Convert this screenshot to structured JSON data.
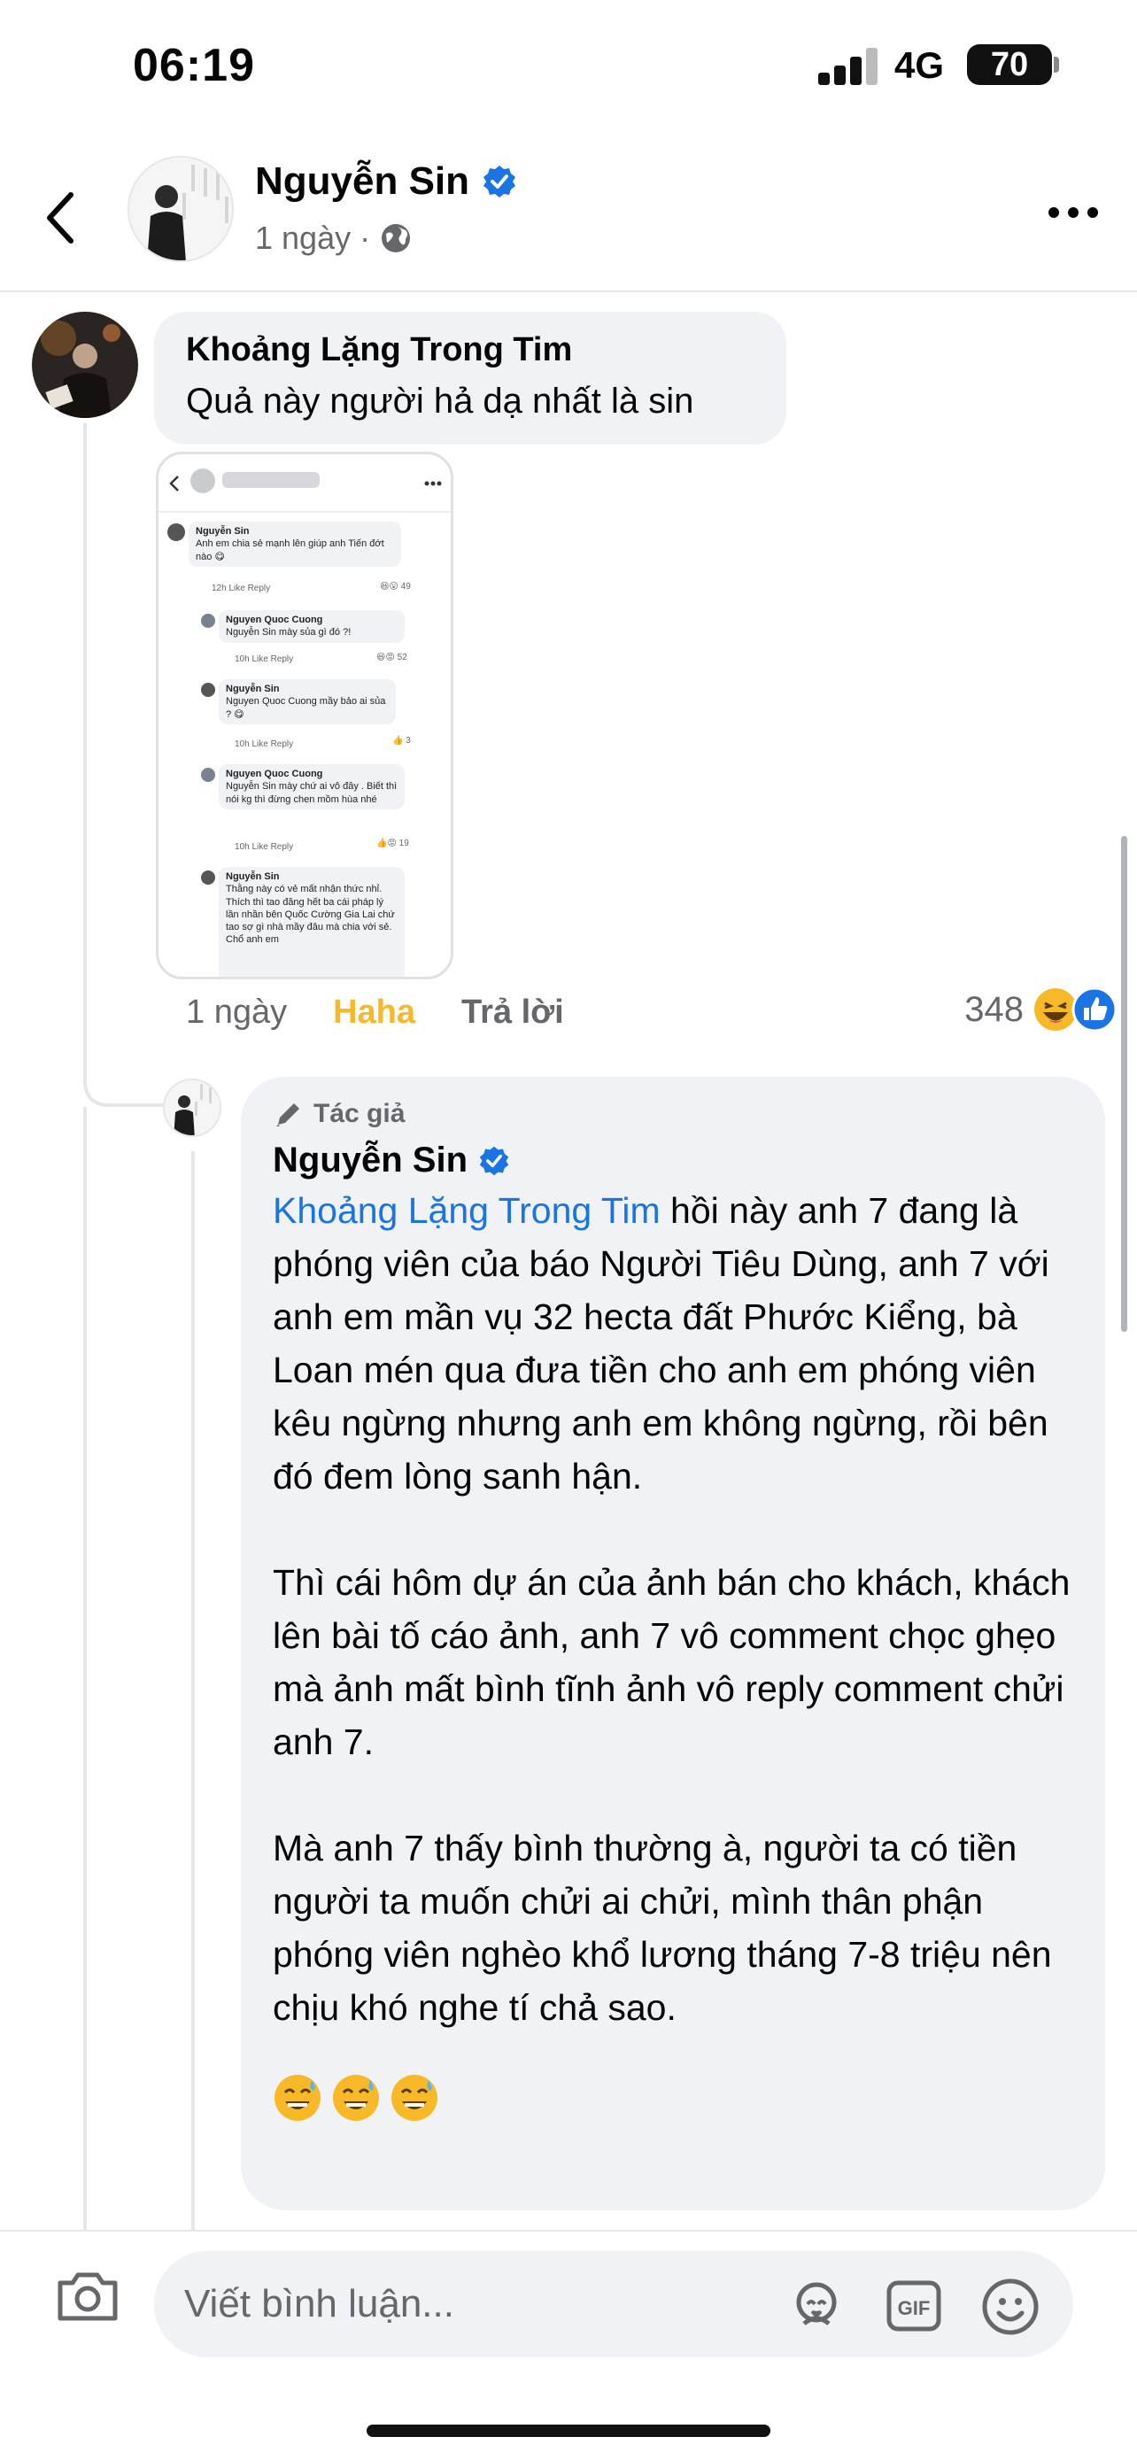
{
  "status_bar": {
    "time": "06:19",
    "network": "4G",
    "battery": "70"
  },
  "header": {
    "name": "Nguyễn Sin",
    "meta_time": "1 ngày",
    "meta_dot": "·",
    "icons": {
      "back": "chevron-left-icon",
      "verified": "verified-badge-icon",
      "audience": "globe-icon",
      "more": "more-dots-icon"
    }
  },
  "comment": {
    "author": "Khoảng Lặng Trong Tim",
    "text": "Quả này người hả dạ nhất là sin",
    "time": "1 ngày",
    "reaction_label": "Haha",
    "reply_label": "Trả lời",
    "reaction_count": "348",
    "reaction_icons": [
      "haha-emoji-icon",
      "like-icon"
    ],
    "attachment": {
      "items": [
        {
          "author": "Nguyễn Sin",
          "text": "Anh em chia sẻ mạnh lên giúp anh Tiến đớt nào 😋",
          "meta": "12h   Like   Reply",
          "count": "49"
        },
        {
          "author": "Nguyen Quoc Cuong",
          "text": "Nguyễn Sin mày sủa gì đó ?!",
          "meta": "10h   Like   Reply",
          "count": "52"
        },
        {
          "author": "Nguyễn Sin",
          "text": "Nguyen Quoc Cuong mầy bảo ai sủa ? 😋",
          "meta": "10h   Like   Reply",
          "count": "3"
        },
        {
          "author": "Nguyen Quoc Cuong",
          "text": "Nguyễn Sin mày chứ ai vô đây . Biết thì nói kg thì đừng chen mồm hùa nhé",
          "meta": "10h   Like   Reply",
          "count": "19"
        },
        {
          "author": "Nguyễn Sin",
          "text": "Thằng này có vẻ mất nhận thức nhỉ. Thích thì tao đăng hết ba cái pháp lý lần nhần bên Quốc Cường Gia Lai chứ tao sợ gì nhà mầy đâu mà chia với sẻ. Chổ anh em",
          "meta": "",
          "count": ""
        }
      ]
    }
  },
  "reply": {
    "author_tag": "Tác giả",
    "author": "Nguyễn Sin",
    "mention": "Khoảng Lặng Trong Tim",
    "paragraph1": " hồi này anh 7 đang là phóng viên của báo Người Tiêu Dùng, anh 7 với anh em mần vụ 32 hecta đất Phước Kiểng, bà Loan mén qua đưa tiền cho anh em phóng viên kêu ngừng nhưng anh em không ngừng, rồi bên đó đem lòng sanh hận.",
    "paragraph2": "Thì cái hôm dự án của ảnh bán cho khách, khách lên bài tố cáo ảnh, anh 7 vô comment chọc ghẹo mà ảnh mất bình tĩnh ảnh vô reply comment chửi anh 7.",
    "paragraph3": "Mà anh 7 thấy bình thường à, người ta có tiền người ta muốn chửi ai chửi, mình thân phận phóng viên nghèo khổ lương tháng 7-8 triệu nên chịu khó nghe tí chả sao.",
    "emojis": [
      "sweat-smile-emoji-icon",
      "sweat-smile-emoji-icon",
      "sweat-smile-emoji-icon"
    ]
  },
  "composer": {
    "placeholder": "Viết bình luận...",
    "icons": [
      "camera-icon",
      "avatar-sticker-icon",
      "gif-icon",
      "emoji-icon"
    ]
  },
  "colors": {
    "accent": "#1b74e4",
    "haha": "#f7b928",
    "bubble": "#f0f2f5",
    "muted": "#65676b"
  }
}
